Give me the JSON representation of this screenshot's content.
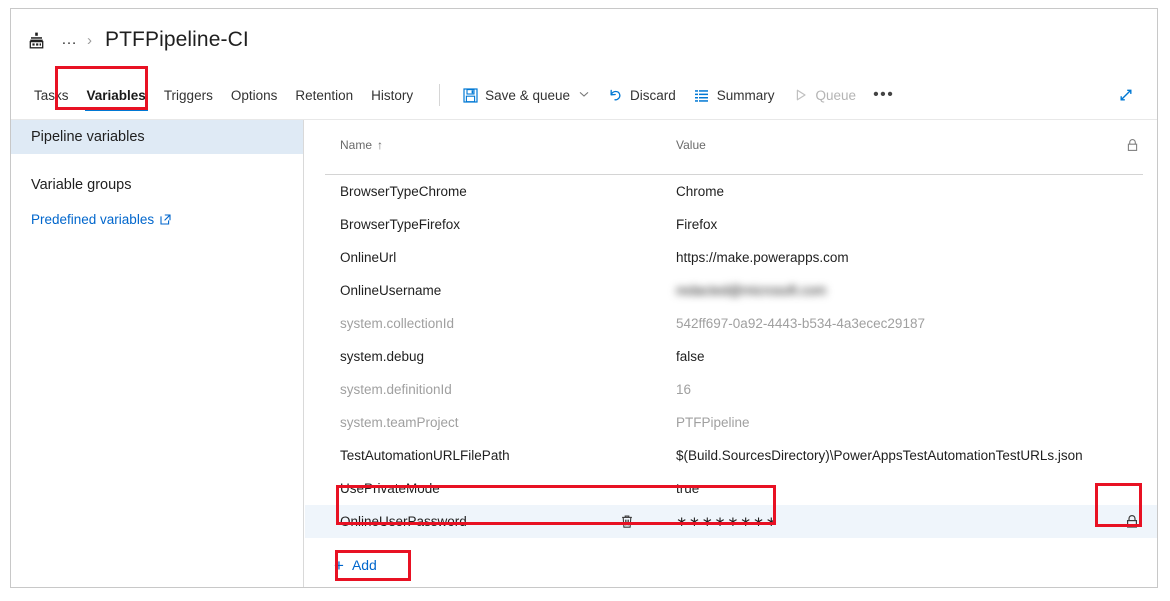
{
  "breadcrumb": {
    "pipeline_icon": "pipeline-icon",
    "ellipsis": "…",
    "separator": "›",
    "title": "PTFPipeline-CI"
  },
  "toolbar": {
    "tabs": [
      {
        "label": "Tasks",
        "active": false
      },
      {
        "label": "Variables",
        "active": true
      },
      {
        "label": "Triggers",
        "active": false
      },
      {
        "label": "Options",
        "active": false
      },
      {
        "label": "Retention",
        "active": false
      },
      {
        "label": "History",
        "active": false
      }
    ],
    "save_queue_label": "Save & queue",
    "save_queue_chevron": "⌄",
    "discard_label": "Discard",
    "summary_label": "Summary",
    "queue_label": "Queue",
    "more_label": "•••",
    "expand_icon": "expand-icon"
  },
  "sidebar": {
    "items": [
      {
        "label": "Pipeline variables",
        "selected": true
      },
      {
        "label": "Variable groups",
        "selected": false
      }
    ],
    "predefined_link": "Predefined variables",
    "predefined_icon": "external-link-icon"
  },
  "table": {
    "headers": {
      "name": "Name",
      "sort_indicator": "↑",
      "value": "Value",
      "lock": "lock-icon"
    },
    "rows": [
      {
        "name": "BrowserTypeChrome",
        "value": "Chrome",
        "muted": false,
        "selected": false,
        "secret": false,
        "locked": false
      },
      {
        "name": "BrowserTypeFirefox",
        "value": "Firefox",
        "muted": false,
        "selected": false,
        "secret": false,
        "locked": false
      },
      {
        "name": "OnlineUrl",
        "value": "https://make.powerapps.com",
        "muted": false,
        "selected": false,
        "secret": false,
        "locked": false
      },
      {
        "name": "OnlineUsername",
        "value": "redacted@microsoft.com",
        "muted": false,
        "selected": false,
        "secret": false,
        "locked": false,
        "blurred": true
      },
      {
        "name": "system.collectionId",
        "value": "542ff697-0a92-4443-b534-4a3ecec29187",
        "muted": true,
        "selected": false,
        "secret": false,
        "locked": false
      },
      {
        "name": "system.debug",
        "value": "false",
        "muted": false,
        "selected": false,
        "secret": false,
        "locked": false
      },
      {
        "name": "system.definitionId",
        "value": "16",
        "muted": true,
        "selected": false,
        "secret": false,
        "locked": false
      },
      {
        "name": "system.teamProject",
        "value": "PTFPipeline",
        "muted": true,
        "selected": false,
        "secret": false,
        "locked": false
      },
      {
        "name": "TestAutomationURLFilePath",
        "value": "$(Build.SourcesDirectory)\\PowerAppsTestAutomationTestURLs.json",
        "muted": false,
        "selected": false,
        "secret": false,
        "locked": false
      },
      {
        "name": "UsePrivateMode",
        "value": "true",
        "muted": false,
        "selected": false,
        "secret": false,
        "locked": false
      },
      {
        "name": "OnlineUserPassword",
        "value": "∗∗∗∗∗∗∗∗",
        "muted": false,
        "selected": true,
        "secret": true,
        "locked": true,
        "delete_icon": "trash-icon",
        "lock_icon": "lock-closed-icon"
      }
    ],
    "add_label": "Add",
    "add_plus": "+"
  },
  "annotations": {
    "accent_red": "#e81123",
    "link_blue": "#0066cc",
    "tab_underline_blue": "#0078d4",
    "selected_row_blue": "#eff5fb",
    "selected_sidebar_blue": "#dfeaf5"
  }
}
